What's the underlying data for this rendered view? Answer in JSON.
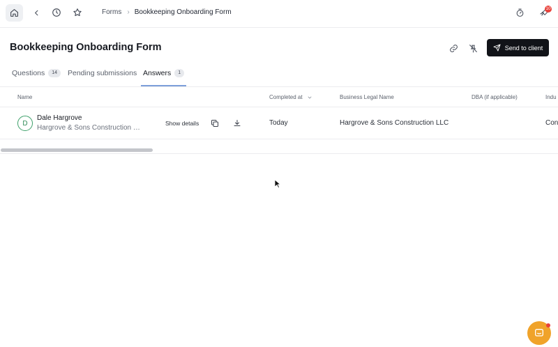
{
  "colors": {
    "accent_underline": "#7b9ed9",
    "send_button_bg": "#111318",
    "avatar_green": "#3da06a",
    "badge_red": "#e8413a",
    "chat_orange": "#f0a32a"
  },
  "topbar": {
    "icons": [
      "home-icon",
      "chevron-left-icon",
      "history-icon",
      "star-icon",
      "timer-icon",
      "rocket-icon"
    ],
    "breadcrumb": {
      "parent": "Forms",
      "current": "Bookkeeping Onboarding Form"
    },
    "notification_count": "10"
  },
  "header": {
    "title": "Bookkeeping Onboarding Form",
    "send_label": "Send to client",
    "icons": [
      "link-icon",
      "pin-off-icon",
      "send-icon"
    ]
  },
  "tabs": [
    {
      "label": "Questions",
      "count": "14",
      "active": false
    },
    {
      "label": "Pending submissions",
      "count": "",
      "active": false
    },
    {
      "label": "Answers",
      "count": "1",
      "active": true
    }
  ],
  "table": {
    "columns": [
      "Name",
      "Completed at",
      "Business Legal Name",
      "DBA (if applicable)",
      "Indu"
    ],
    "rows": [
      {
        "initial": "D",
        "name": "Dale Hargrove",
        "company": "Hargrove & Sons Construction LLC",
        "show_details_label": "Show details",
        "completed_at": "Today",
        "business_legal_name": "Hargrove & Sons Construction LLC",
        "dba": "",
        "industry": "Con"
      }
    ]
  }
}
